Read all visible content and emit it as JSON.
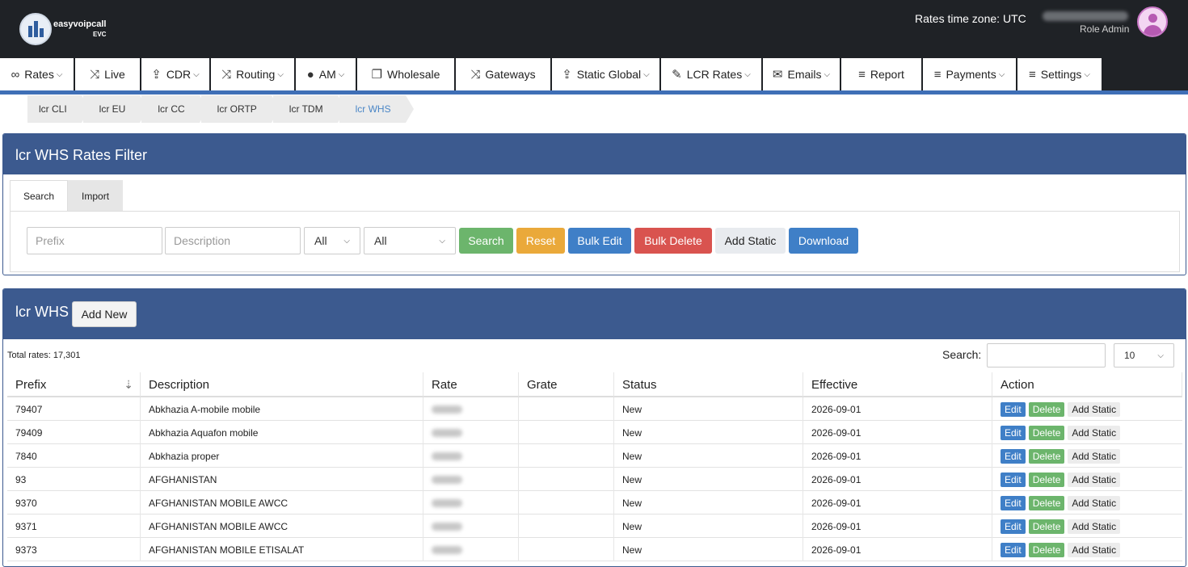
{
  "header": {
    "logo_text": "easyvoipcall",
    "logo_sub": "EVC",
    "timezone": "Rates time zone: UTC",
    "role": "Role Admin"
  },
  "nav": [
    {
      "label": "Rates",
      "icon": "infinity-icon",
      "glyph": "∞",
      "caret": true
    },
    {
      "label": "Live",
      "icon": "shuffle-icon",
      "glyph": "⤨",
      "caret": false
    },
    {
      "label": "CDR",
      "icon": "upload-icon",
      "glyph": "⇪",
      "caret": true
    },
    {
      "label": "Routing",
      "icon": "shuffle-icon",
      "glyph": "⤨",
      "caret": true
    },
    {
      "label": "AM",
      "icon": "chat-icon",
      "glyph": "●",
      "caret": true
    },
    {
      "label": "Wholesale",
      "icon": "external-icon",
      "glyph": "❐",
      "caret": false
    },
    {
      "label": "Gateways",
      "icon": "shuffle-icon",
      "glyph": "⤨",
      "caret": false
    },
    {
      "label": "Static Global",
      "icon": "upload-icon",
      "glyph": "⇪",
      "caret": true
    },
    {
      "label": "LCR Rates",
      "icon": "edit-icon",
      "glyph": "✎",
      "caret": true
    },
    {
      "label": "Emails",
      "icon": "mail-icon",
      "glyph": "✉",
      "caret": true
    },
    {
      "label": "Report",
      "icon": "list-icon",
      "glyph": "≡",
      "caret": false
    },
    {
      "label": "Payments",
      "icon": "list-icon",
      "glyph": "≡",
      "caret": true
    },
    {
      "label": "Settings",
      "icon": "list-icon",
      "glyph": "≡",
      "caret": true
    }
  ],
  "breadcrumbs": [
    "lcr CLI",
    "lcr EU",
    "lcr CC",
    "lcr ORTP",
    "lcr TDM",
    "lcr WHS"
  ],
  "filter": {
    "title": "lcr WHS Rates Filter",
    "tabs": [
      "Search",
      "Import"
    ],
    "prefix_placeholder": "Prefix",
    "description_placeholder": "Description",
    "select1": "All",
    "select2": "All",
    "buttons": {
      "search": "Search",
      "reset": "Reset",
      "bulk_edit": "Bulk Edit",
      "bulk_delete": "Bulk Delete",
      "add_static": "Add Static",
      "download": "Download"
    }
  },
  "list": {
    "title": "lcr WHS",
    "add_new": "Add New",
    "total": "Total rates: 17,301",
    "search_label": "Search:",
    "page_size": "10",
    "columns": [
      "Prefix",
      "Description",
      "Rate",
      "Grate",
      "Status",
      "Effective",
      "Action"
    ],
    "actions": {
      "edit": "Edit",
      "delete": "Delete",
      "add_static": "Add Static"
    },
    "rows": [
      {
        "prefix": "79407",
        "description": "Abkhazia A-mobile mobile",
        "status": "New",
        "effective": "2026-09-01"
      },
      {
        "prefix": "79409",
        "description": "Abkhazia Aquafon mobile",
        "status": "New",
        "effective": "2026-09-01"
      },
      {
        "prefix": "7840",
        "description": "Abkhazia proper",
        "status": "New",
        "effective": "2026-09-01"
      },
      {
        "prefix": "93",
        "description": "AFGHANISTAN",
        "status": "New",
        "effective": "2026-09-01"
      },
      {
        "prefix": "9370",
        "description": "AFGHANISTAN MOBILE AWCC",
        "status": "New",
        "effective": "2026-09-01"
      },
      {
        "prefix": "9371",
        "description": "AFGHANISTAN MOBILE AWCC",
        "status": "New",
        "effective": "2026-09-01"
      },
      {
        "prefix": "9373",
        "description": "AFGHANISTAN MOBILE ETISALAT",
        "status": "New",
        "effective": "2026-09-01"
      }
    ]
  },
  "colors": {
    "header": "#1f2226",
    "panel": "#3c5a8f",
    "accent": "#3f7fc7"
  }
}
